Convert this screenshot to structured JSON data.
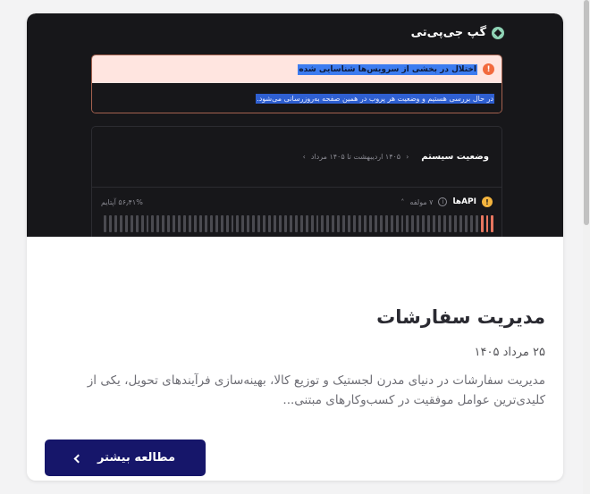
{
  "thumbnail": {
    "brand_name": "گپ جی‌پی‌تی",
    "brand_icon": "logo-icon",
    "alert": {
      "icon": "!",
      "title": "اختلال در بخشی از سرویس‌ها شناسایی شده",
      "message": "در حال بررسی هستیم و وضعیت هر پروب در همین صفحه به‌روزرسانی می‌شود."
    },
    "status": {
      "title": "وضعیت سیستم",
      "range": "۱۴۰۵ اردیبهشت تا ۱۴۰۵ مرداد",
      "api_label": "APIها",
      "warn_icon": "!",
      "components": "۷ مولفه",
      "uptime": "۵۶٫۴۱% آپتایم",
      "bar_states": [
        "g",
        "g",
        "g",
        "g",
        "g",
        "g",
        "g",
        "g",
        "g",
        "g",
        "g",
        "g",
        "g",
        "g",
        "g",
        "g",
        "g",
        "g",
        "g",
        "g",
        "g",
        "g",
        "g",
        "g",
        "g",
        "g",
        "g",
        "g",
        "g",
        "g",
        "g",
        "g",
        "g",
        "g",
        "g",
        "g",
        "g",
        "g",
        "g",
        "g",
        "g",
        "g",
        "g",
        "g",
        "g",
        "g",
        "g",
        "g",
        "g",
        "g",
        "g",
        "g",
        "g",
        "g",
        "g",
        "g",
        "g",
        "g",
        "g",
        "g",
        "g",
        "g",
        "g",
        "g",
        "g",
        "g",
        "g",
        "g",
        "g",
        "g",
        "g",
        "r",
        "r",
        "r"
      ]
    },
    "colors": {
      "alert_bg": "#ffe5e0",
      "warning": "#f4b43e",
      "danger": "#f26a3d",
      "bar_ok": "#4a4a50",
      "bar_bad": "#e8765f"
    }
  },
  "article": {
    "title": "مدیریت سفارشات",
    "date": "۲۵ مرداد ۱۴۰۵",
    "excerpt": "مدیریت سفارشات در دنیای مدرن لجستیک و توزیع کالا، بهینه‌سازی فرآیندهای تحویل، یکی از کلیدی‌ترین عوامل موفقیت در کسب‌وکارهای مبتنی...",
    "button_label": "مطالعه بیشتر",
    "button_icon": "chevron-left-icon",
    "accent": "#16166a"
  }
}
